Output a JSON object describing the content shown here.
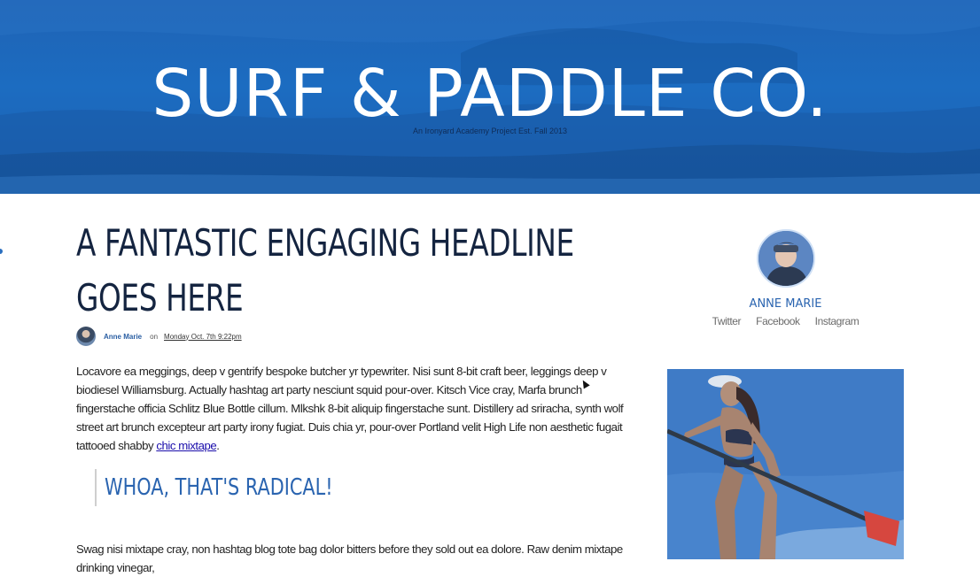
{
  "header": {
    "site_title": "SURF & PADDLE CO.",
    "tagline": "An Ironyard Academy Project Est. Fall 2013"
  },
  "article": {
    "headline": "A FANTASTIC ENGAGING HEADLINE GOES HERE",
    "byline": {
      "author": "Anne Marie",
      "connector": "on",
      "date": "Monday Oct. 7th 9:22pm"
    },
    "paragraph_1": "Locavore ea meggings, deep v gentrify bespoke butcher yr typewriter. Nisi sunt 8-bit craft beer, leggings deep v biodiesel Williamsburg. Actually hashtag art party nesciunt squid pour-over. Kitsch Vice cray, Marfa brunch fingerstache officia Schlitz Blue Bottle cillum. Mlkshk 8-bit aliquip fingerstache sunt. Distillery ad sriracha, synth wolf street art brunch excepteur art party irony fugiat. Duis chia yr, pour-over Portland velit High Life non aesthetic fugait tattooed shabby",
    "paragraph_1_link": "chic mixtape",
    "paragraph_1_end": ".",
    "pull_quote": "WHOA, THAT'S RADICAL!",
    "paragraph_2": "Swag nisi mixtape cray, non hashtag blog tote bag dolor bitters before they sold out ea dolore. Raw denim mixtape drinking vinegar,"
  },
  "sidebar": {
    "author_name": "ANNE MARIE",
    "social_links": [
      "Twitter",
      "Facebook",
      "Instagram"
    ]
  },
  "colors": {
    "hero_blue": "#1c6cc1",
    "headline_navy": "#142440",
    "accent_blue": "#2a64b0",
    "link": "#1a0dab"
  }
}
